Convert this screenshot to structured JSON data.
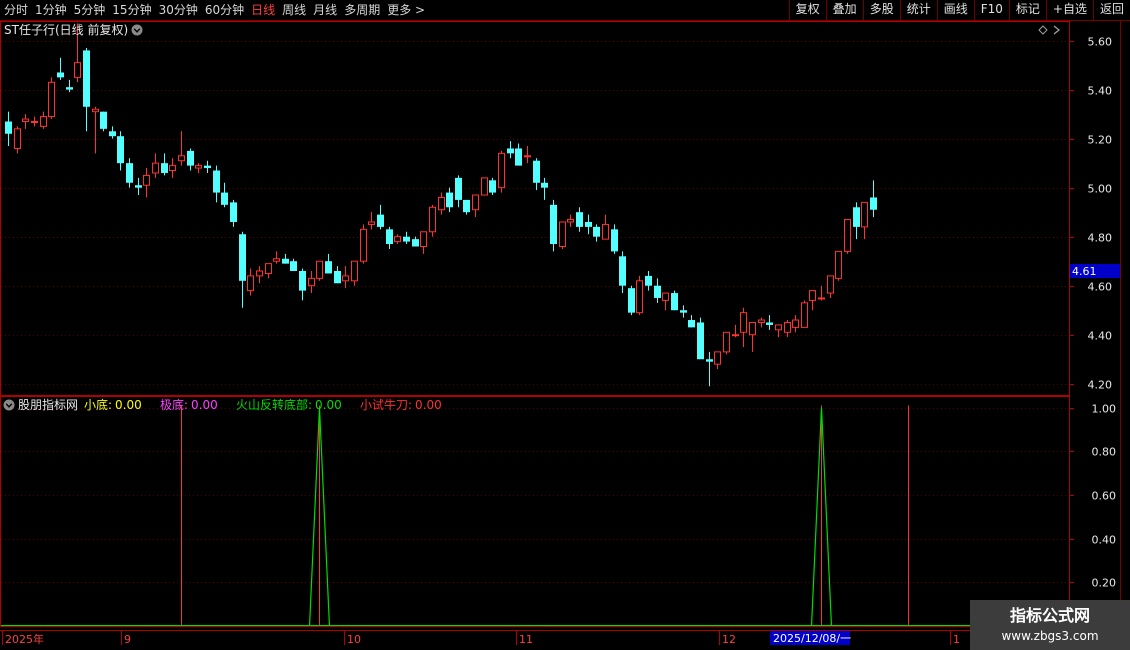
{
  "toolbar": {
    "periods": [
      "分时",
      "1分钟",
      "5分钟",
      "15分钟",
      "30分钟",
      "60分钟",
      "日线",
      "周线",
      "月线",
      "多周期",
      "更多 >"
    ],
    "active_period": "日线",
    "tools": [
      "复权",
      "叠加",
      "多股",
      "统计",
      "画线",
      "F10",
      "标记",
      "+自选",
      "返回"
    ]
  },
  "main_panel": {
    "stock_title": "ST任子行(日线 前复权)",
    "price_axis": [
      "5.60",
      "5.40",
      "5.20",
      "5.00",
      "4.80",
      "4.60",
      "4.40",
      "4.20"
    ],
    "last_price_tag": "4.61"
  },
  "indicator_panel": {
    "name": "股朋指标网",
    "legend": [
      {
        "label": "小底:",
        "value": "0.00",
        "color": "#ffff00"
      },
      {
        "label": "极底:",
        "value": "0.00",
        "color": "#ff40ff"
      },
      {
        "label": "火山反转底部:",
        "value": "0.00",
        "color": "#00dd00"
      },
      {
        "label": "小试牛刀:",
        "value": "0.00",
        "color": "#ff3030"
      }
    ],
    "axis": [
      "1.00",
      "0.80",
      "0.60",
      "0.40",
      "0.20"
    ]
  },
  "date_axis": {
    "labels": [
      "2025年",
      "9",
      "10",
      "11",
      "12",
      "1"
    ],
    "cursor_date": "2025/12/08/一"
  },
  "watermark": {
    "line1": "指标公式网",
    "line2": "www.zbgs3.com"
  },
  "colors": {
    "up": "#ff3232",
    "down": "#54ffff",
    "grid": "#5a0000",
    "frame": "#b00000",
    "axis_text": "#e8e8e8"
  },
  "chart_data": {
    "type": "candlestick",
    "price_range": [
      4.15,
      5.68
    ],
    "series": [
      {
        "name": "K线",
        "ohlc": [
          [
            5.27,
            5.31,
            5.17,
            5.22
          ],
          [
            5.16,
            5.25,
            5.14,
            5.24
          ],
          [
            5.27,
            5.3,
            5.24,
            5.28
          ],
          [
            5.27,
            5.29,
            5.25,
            5.27
          ],
          [
            5.25,
            5.31,
            5.24,
            5.29
          ],
          [
            5.29,
            5.45,
            5.28,
            5.43
          ],
          [
            5.47,
            5.53,
            5.44,
            5.45
          ],
          [
            5.41,
            5.44,
            5.39,
            5.4
          ],
          [
            5.45,
            5.67,
            5.43,
            5.51
          ],
          [
            5.56,
            5.57,
            5.23,
            5.33
          ],
          [
            5.31,
            5.33,
            5.14,
            5.32
          ],
          [
            5.31,
            5.31,
            5.23,
            5.24
          ],
          [
            5.23,
            5.25,
            5.2,
            5.21
          ],
          [
            5.21,
            5.23,
            5.07,
            5.1
          ],
          [
            5.1,
            5.12,
            5.0,
            5.02
          ],
          [
            5.01,
            5.04,
            4.97,
            5.0
          ],
          [
            5.01,
            5.08,
            4.96,
            5.05
          ],
          [
            5.06,
            5.14,
            5.04,
            5.1
          ],
          [
            5.1,
            5.14,
            5.05,
            5.06
          ],
          [
            5.07,
            5.12,
            5.04,
            5.09
          ],
          [
            5.11,
            5.23,
            5.09,
            5.13
          ],
          [
            5.15,
            5.16,
            5.07,
            5.09
          ],
          [
            5.08,
            5.1,
            5.06,
            5.09
          ],
          [
            5.09,
            5.11,
            5.06,
            5.08
          ],
          [
            5.07,
            5.09,
            4.94,
            4.98
          ],
          [
            4.98,
            5.02,
            4.92,
            4.93
          ],
          [
            4.94,
            4.95,
            4.84,
            4.86
          ],
          [
            4.81,
            4.82,
            4.51,
            4.62
          ],
          [
            4.58,
            4.67,
            4.56,
            4.64
          ],
          [
            4.64,
            4.68,
            4.61,
            4.66
          ],
          [
            4.65,
            4.67,
            4.63,
            4.69
          ],
          [
            4.7,
            4.74,
            4.69,
            4.71
          ],
          [
            4.71,
            4.73,
            4.69,
            4.69
          ],
          [
            4.7,
            4.71,
            4.66,
            4.66
          ],
          [
            4.66,
            4.67,
            4.54,
            4.58
          ],
          [
            4.6,
            4.66,
            4.57,
            4.63
          ],
          [
            4.63,
            4.7,
            4.62,
            4.7
          ],
          [
            4.7,
            4.73,
            4.68,
            4.65
          ],
          [
            4.66,
            4.68,
            4.61,
            4.61
          ],
          [
            4.62,
            4.68,
            4.59,
            4.64
          ],
          [
            4.62,
            4.64,
            4.6,
            4.7
          ],
          [
            4.7,
            4.85,
            4.69,
            4.83
          ],
          [
            4.85,
            4.9,
            4.83,
            4.86
          ],
          [
            4.89,
            4.93,
            4.83,
            4.84
          ],
          [
            4.83,
            4.84,
            4.75,
            4.77
          ],
          [
            4.78,
            4.81,
            4.77,
            4.8
          ],
          [
            4.8,
            4.82,
            4.77,
            4.78
          ],
          [
            4.79,
            4.8,
            4.76,
            4.76
          ],
          [
            4.76,
            4.77,
            4.73,
            4.82
          ],
          [
            4.82,
            4.93,
            4.8,
            4.92
          ],
          [
            4.91,
            4.98,
            4.89,
            4.96
          ],
          [
            4.98,
            5.0,
            4.9,
            4.92
          ],
          [
            5.04,
            5.05,
            4.92,
            4.95
          ],
          [
            4.95,
            4.95,
            4.89,
            4.9
          ],
          [
            4.91,
            4.94,
            4.88,
            4.97
          ],
          [
            4.97,
            5.04,
            4.97,
            5.04
          ],
          [
            5.03,
            5.04,
            4.97,
            4.98
          ],
          [
            5.0,
            5.15,
            4.98,
            5.14
          ],
          [
            5.16,
            5.19,
            5.12,
            5.14
          ],
          [
            5.16,
            5.18,
            5.1,
            5.09
          ],
          [
            5.13,
            5.17,
            5.1,
            5.13
          ],
          [
            5.11,
            5.12,
            4.99,
            5.02
          ],
          [
            5.02,
            5.04,
            4.95,
            5.0
          ],
          [
            4.93,
            4.95,
            4.74,
            4.77
          ],
          [
            4.76,
            4.79,
            4.75,
            4.86
          ],
          [
            4.86,
            4.89,
            4.84,
            4.87
          ],
          [
            4.9,
            4.92,
            4.82,
            4.84
          ],
          [
            4.86,
            4.89,
            4.81,
            4.84
          ],
          [
            4.84,
            4.85,
            4.78,
            4.8
          ],
          [
            4.79,
            4.89,
            4.8,
            4.85
          ],
          [
            4.83,
            4.85,
            4.73,
            4.74
          ],
          [
            4.72,
            4.74,
            4.57,
            4.6
          ],
          [
            4.59,
            4.6,
            4.48,
            4.49
          ],
          [
            4.49,
            4.64,
            4.48,
            4.62
          ],
          [
            4.64,
            4.66,
            4.58,
            4.6
          ],
          [
            4.6,
            4.63,
            4.53,
            4.55
          ],
          [
            4.54,
            4.56,
            4.5,
            4.57
          ],
          [
            4.57,
            4.58,
            4.5,
            4.5
          ],
          [
            4.5,
            4.52,
            4.47,
            4.49
          ],
          [
            4.46,
            4.48,
            4.43,
            4.43
          ],
          [
            4.45,
            4.47,
            4.34,
            4.3
          ],
          [
            4.3,
            4.33,
            4.19,
            4.29
          ],
          [
            4.28,
            4.32,
            4.26,
            4.33
          ],
          [
            4.33,
            4.39,
            4.32,
            4.41
          ],
          [
            4.4,
            4.44,
            4.39,
            4.4
          ],
          [
            4.41,
            4.51,
            4.35,
            4.49
          ],
          [
            4.4,
            4.45,
            4.33,
            4.45
          ],
          [
            4.45,
            4.47,
            4.43,
            4.46
          ],
          [
            4.45,
            4.48,
            4.42,
            4.44
          ],
          [
            4.42,
            4.44,
            4.39,
            4.44
          ],
          [
            4.41,
            4.46,
            4.39,
            4.45
          ],
          [
            4.43,
            4.48,
            4.41,
            4.46
          ],
          [
            4.43,
            4.54,
            4.43,
            4.53
          ],
          [
            4.54,
            4.58,
            4.5,
            4.58
          ],
          [
            4.55,
            4.6,
            4.54,
            4.55
          ],
          [
            4.57,
            4.63,
            4.55,
            4.64
          ],
          [
            4.63,
            4.68,
            4.62,
            4.74
          ],
          [
            4.74,
            4.85,
            4.73,
            4.87
          ],
          [
            4.92,
            4.94,
            4.79,
            4.84
          ],
          [
            4.84,
            4.94,
            4.79,
            4.94
          ],
          [
            4.96,
            5.03,
            4.88,
            4.91
          ]
        ]
      }
    ],
    "indicator": {
      "volcano_reversal_bottom_peaks": [
        {
          "bar_index": 36,
          "value": 1.0
        },
        {
          "bar_index": 94,
          "value": 1.0
        }
      ],
      "small_test_signals_bar_index": [
        20,
        36,
        94,
        104
      ]
    }
  }
}
